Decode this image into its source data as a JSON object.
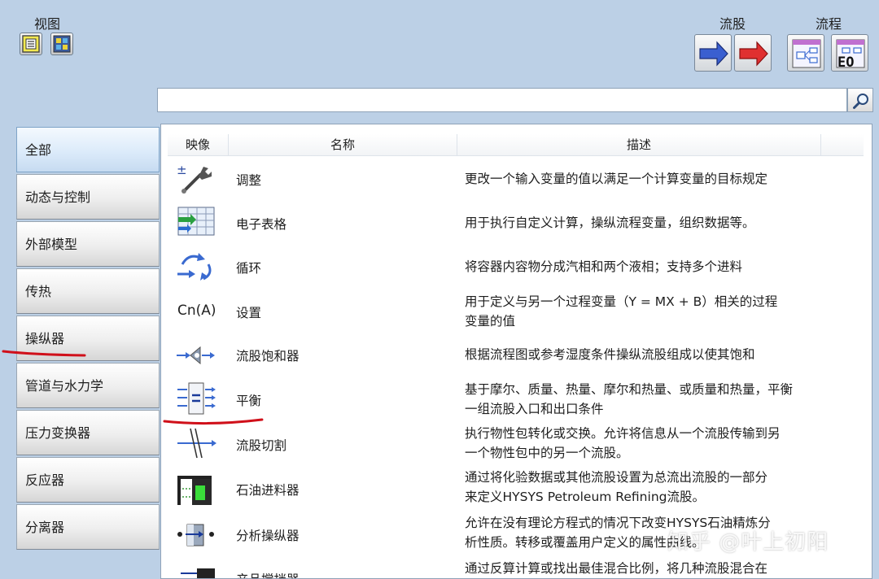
{
  "toolbar": {
    "view_label": "视图",
    "stream_label": "流股",
    "flow_label": "流程",
    "flow_button_text": "EO"
  },
  "search": {
    "value": "",
    "placeholder": ""
  },
  "categories": [
    {
      "label": "全部",
      "selected": true
    },
    {
      "label": "动态与控制",
      "selected": false
    },
    {
      "label": "外部模型",
      "selected": false
    },
    {
      "label": "传热",
      "selected": false
    },
    {
      "label": "操纵器",
      "selected": false
    },
    {
      "label": "管道与水力学",
      "selected": false
    },
    {
      "label": "压力变换器",
      "selected": false
    },
    {
      "label": "反应器",
      "selected": false
    },
    {
      "label": "分离器",
      "selected": false
    }
  ],
  "table": {
    "columns": [
      "映像",
      "名称",
      "描述"
    ],
    "rows": [
      {
        "icon": "wrench-adjust-icon",
        "icon_text": "±",
        "name": "调整",
        "desc": [
          "更改一个输入变量的值以满足一个计算变量的目标规定"
        ]
      },
      {
        "icon": "spreadsheet-icon",
        "name": "电子表格",
        "desc": [
          "用于执行自定义计算，操纵流程变量，组织数据等。"
        ]
      },
      {
        "icon": "recycle-icon",
        "name": "循环",
        "desc": [
          "将容器内容物分成汽相和两个液相；支持多个进料"
        ]
      },
      {
        "icon": "set-icon",
        "icon_text": "Cn(A)",
        "name": "设置",
        "desc": [
          "用于定义与另一个过程变量（Y = MX + B）相关的过程",
          "变量的值"
        ]
      },
      {
        "icon": "stream-saturator-icon",
        "name": "流股饱和器",
        "desc": [
          "根据流程图或参考湿度条件操纵流股组成以使其饱和"
        ]
      },
      {
        "icon": "balance-icon",
        "name": "平衡",
        "desc": [
          "基于摩尔、质量、热量、摩尔和热量、或质量和热量，平衡",
          "一组流股入口和出口条件"
        ]
      },
      {
        "icon": "stream-cutter-icon",
        "name": "流股切割",
        "desc": [
          "执行物性包转化或交换。允许将信息从一个流股传输到另",
          "一个物性包中的另一个流股。"
        ]
      },
      {
        "icon": "petroleum-feeder-icon",
        "name": "石油进料器",
        "desc": [
          "通过将化验数据或其他流股设置为总流出流股的一部分",
          "来定义HYSYS Petroleum Refining流股。"
        ]
      },
      {
        "icon": "assay-manipulator-icon",
        "name": "分析操纵器",
        "desc": [
          "允许在没有理论方程式的情况下改变HYSYS石油精炼分",
          "析性质。转移或覆盖用户定义的属性曲线。"
        ]
      },
      {
        "icon": "product-blender-icon",
        "name": "产品搅拌器",
        "desc": [
          "通过反算计算或找出最佳混合比例，将几种流股混合在"
        ]
      }
    ]
  },
  "watermark": "知乎 @叶上初阳",
  "colors": {
    "background": "#bcd0e6",
    "selected_category": "#dcebfa",
    "annotation": "#d0101a",
    "stream_blue": "#3a5fd0",
    "stream_red": "#e03030"
  }
}
